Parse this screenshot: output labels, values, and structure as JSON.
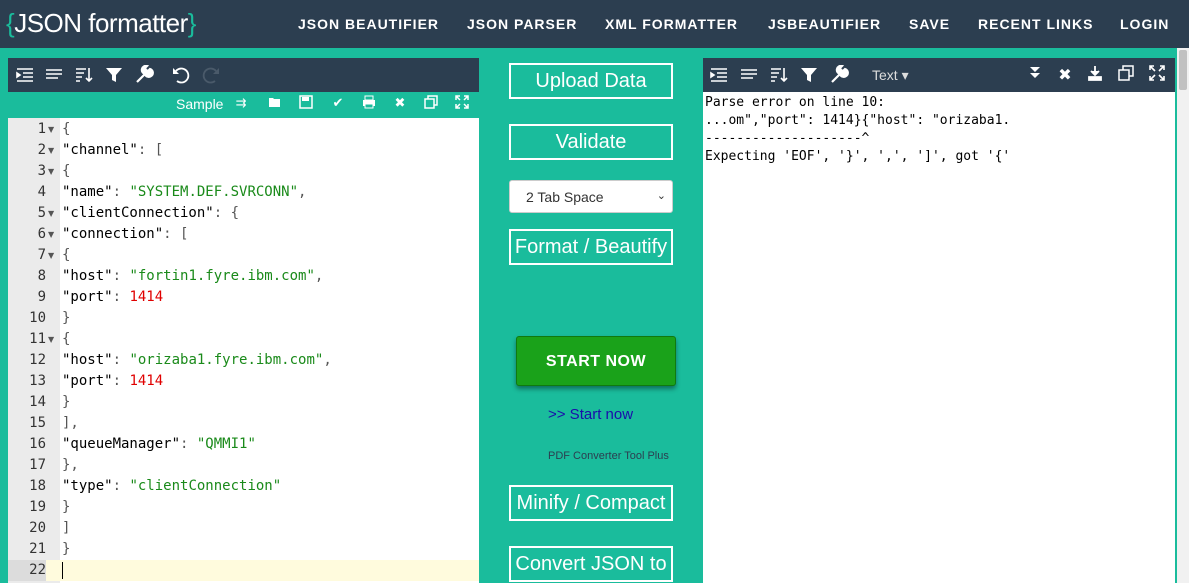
{
  "nav": {
    "logo": "JSON formatter",
    "links": [
      "JSON BEAUTIFIER",
      "JSON PARSER",
      "XML FORMATTER",
      "JSBEAUTIFIER",
      "SAVE",
      "RECENT LINKS",
      "LOGIN"
    ]
  },
  "editor": {
    "sample_label": "Sample",
    "lines": [
      {
        "num": "1",
        "fold": true,
        "tokens": [
          {
            "t": "{",
            "c": "p"
          }
        ]
      },
      {
        "num": "2",
        "fold": true,
        "tokens": [
          {
            "t": "\"channel\"",
            "c": "k"
          },
          {
            "t": ": [",
            "c": "p"
          }
        ]
      },
      {
        "num": "3",
        "fold": true,
        "tokens": [
          {
            "t": "{",
            "c": "p"
          }
        ]
      },
      {
        "num": "4",
        "fold": false,
        "tokens": [
          {
            "t": "\"name\"",
            "c": "k"
          },
          {
            "t": ": ",
            "c": "p"
          },
          {
            "t": "\"SYSTEM.DEF.SVRCONN\"",
            "c": "s"
          },
          {
            "t": ",",
            "c": "p"
          }
        ]
      },
      {
        "num": "5",
        "fold": true,
        "tokens": [
          {
            "t": "\"clientConnection\"",
            "c": "k"
          },
          {
            "t": ": {",
            "c": "p"
          }
        ]
      },
      {
        "num": "6",
        "fold": true,
        "tokens": [
          {
            "t": "\"connection\"",
            "c": "k"
          },
          {
            "t": ": [",
            "c": "p"
          }
        ]
      },
      {
        "num": "7",
        "fold": true,
        "tokens": [
          {
            "t": "{",
            "c": "p"
          }
        ]
      },
      {
        "num": "8",
        "fold": false,
        "tokens": [
          {
            "t": "\"host\"",
            "c": "k"
          },
          {
            "t": ": ",
            "c": "p"
          },
          {
            "t": "\"fortin1.fyre.ibm.com\"",
            "c": "s"
          },
          {
            "t": ",",
            "c": "p"
          }
        ]
      },
      {
        "num": "9",
        "fold": false,
        "tokens": [
          {
            "t": "\"port\"",
            "c": "k"
          },
          {
            "t": ": ",
            "c": "p"
          },
          {
            "t": "1414",
            "c": "n"
          }
        ]
      },
      {
        "num": "10",
        "fold": false,
        "tokens": [
          {
            "t": "}",
            "c": "p"
          }
        ]
      },
      {
        "num": "11",
        "fold": true,
        "tokens": [
          {
            "t": "{",
            "c": "p"
          }
        ]
      },
      {
        "num": "12",
        "fold": false,
        "tokens": [
          {
            "t": "\"host\"",
            "c": "k"
          },
          {
            "t": ": ",
            "c": "p"
          },
          {
            "t": "\"orizaba1.fyre.ibm.com\"",
            "c": "s"
          },
          {
            "t": ",",
            "c": "p"
          }
        ]
      },
      {
        "num": "13",
        "fold": false,
        "tokens": [
          {
            "t": "\"port\"",
            "c": "k"
          },
          {
            "t": ": ",
            "c": "p"
          },
          {
            "t": "1414",
            "c": "n"
          }
        ]
      },
      {
        "num": "14",
        "fold": false,
        "tokens": [
          {
            "t": "}",
            "c": "p"
          }
        ]
      },
      {
        "num": "15",
        "fold": false,
        "tokens": [
          {
            "t": "],",
            "c": "p"
          }
        ]
      },
      {
        "num": "16",
        "fold": false,
        "tokens": [
          {
            "t": "\"queueManager\"",
            "c": "k"
          },
          {
            "t": ": ",
            "c": "p"
          },
          {
            "t": "\"QMMI1\"",
            "c": "s"
          }
        ]
      },
      {
        "num": "17",
        "fold": false,
        "tokens": [
          {
            "t": "},",
            "c": "p"
          }
        ]
      },
      {
        "num": "18",
        "fold": false,
        "tokens": [
          {
            "t": "\"type\"",
            "c": "k"
          },
          {
            "t": ": ",
            "c": "p"
          },
          {
            "t": "\"clientConnection\"",
            "c": "s"
          }
        ]
      },
      {
        "num": "19",
        "fold": false,
        "tokens": [
          {
            "t": "}",
            "c": "p"
          }
        ]
      },
      {
        "num": "20",
        "fold": false,
        "tokens": [
          {
            "t": "]",
            "c": "p"
          }
        ]
      },
      {
        "num": "21",
        "fold": false,
        "tokens": [
          {
            "t": "}",
            "c": "p"
          }
        ]
      },
      {
        "num": "22",
        "fold": false,
        "active": true,
        "tokens": []
      }
    ]
  },
  "middle": {
    "upload_label": "Upload Data",
    "validate_label": "Validate",
    "tab_space_value": "2 Tab Space",
    "format_label": "Format / Beautify",
    "start_now_label": "START NOW",
    "start_now_link": ">> Start now",
    "pdf_text": "PDF Converter Tool Plus",
    "minify_label": "Minify / Compact",
    "convert_label": "Convert JSON to"
  },
  "output": {
    "mode_label": "Text ▾",
    "lines": [
      "Parse error on line 10:",
      "...om\",\"port\": 1414}{\"host\": \"orizaba1.",
      "--------------------^",
      "Expecting 'EOF', '}', ',', ']', got '{'"
    ]
  },
  "colors": {
    "teal": "#1abc9c",
    "navy": "#2c3e50",
    "start_green": "#1aa21a"
  }
}
